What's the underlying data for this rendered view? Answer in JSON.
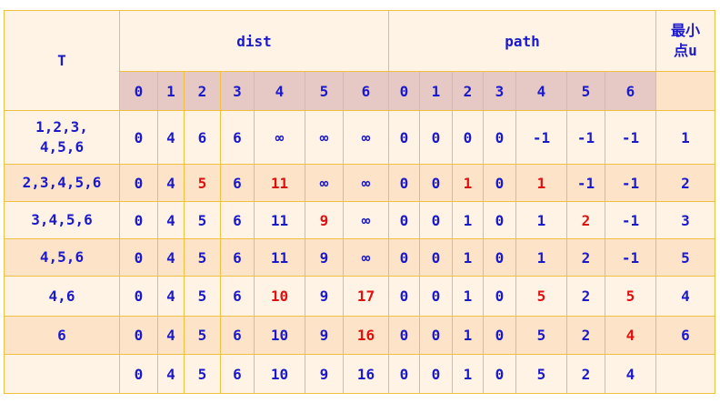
{
  "header": {
    "t": "T",
    "dist": "dist",
    "path": "path",
    "minu": "最小点u",
    "indices": [
      "0",
      "1",
      "2",
      "3",
      "4",
      "5",
      "6"
    ]
  },
  "rows": [
    {
      "t": "1,2,3,4,5,6",
      "t_lines": [
        "1,2,3,",
        "4,5,6"
      ],
      "dist": [
        "0",
        "4",
        "6",
        "6",
        "∞",
        "∞",
        "∞"
      ],
      "path": [
        "0",
        "0",
        "0",
        "0",
        "-1",
        "-1",
        "-1"
      ],
      "u": "1",
      "red_dist": [],
      "red_path": [],
      "shade": "light"
    },
    {
      "t": "2,3,4,5,6",
      "t_lines": [
        "2,3,4,5,6"
      ],
      "dist": [
        "0",
        "4",
        "5",
        "6",
        "11",
        "∞",
        "∞"
      ],
      "path": [
        "0",
        "0",
        "1",
        "0",
        "1",
        "-1",
        "-1"
      ],
      "u": "2",
      "red_dist": [
        2,
        4
      ],
      "red_path": [
        2,
        4
      ],
      "shade": "dark"
    },
    {
      "t": "3,4,5,6",
      "t_lines": [
        "3,4,5,6"
      ],
      "dist": [
        "0",
        "4",
        "5",
        "6",
        "11",
        "9",
        "∞"
      ],
      "path": [
        "0",
        "0",
        "1",
        "0",
        "1",
        "2",
        "-1"
      ],
      "u": "3",
      "red_dist": [
        5
      ],
      "red_path": [
        5
      ],
      "shade": "light"
    },
    {
      "t": "4,5,6",
      "t_lines": [
        "4,5,6"
      ],
      "dist": [
        "0",
        "4",
        "5",
        "6",
        "11",
        "9",
        "∞"
      ],
      "path": [
        "0",
        "0",
        "1",
        "0",
        "1",
        "2",
        "-1"
      ],
      "u": "5",
      "red_dist": [],
      "red_path": [],
      "shade": "dark"
    },
    {
      "t": "4,6",
      "t_lines": [
        "4,6"
      ],
      "dist": [
        "0",
        "4",
        "5",
        "6",
        "10",
        "9",
        "17"
      ],
      "path": [
        "0",
        "0",
        "1",
        "0",
        "5",
        "2",
        "5"
      ],
      "u": "4",
      "red_dist": [
        4,
        6
      ],
      "red_path": [
        4,
        6
      ],
      "shade": "light"
    },
    {
      "t": "6",
      "t_lines": [
        "6"
      ],
      "dist": [
        "0",
        "4",
        "5",
        "6",
        "10",
        "9",
        "16"
      ],
      "path": [
        "0",
        "0",
        "1",
        "0",
        "5",
        "2",
        "4"
      ],
      "u": "6",
      "red_dist": [
        6
      ],
      "red_path": [
        6
      ],
      "shade": "dark"
    },
    {
      "t": "",
      "t_lines": [
        ""
      ],
      "dist": [
        "0",
        "4",
        "5",
        "6",
        "10",
        "9",
        "16"
      ],
      "path": [
        "0",
        "0",
        "1",
        "0",
        "5",
        "2",
        "4"
      ],
      "u": "",
      "red_dist": [],
      "red_path": [],
      "shade": "light"
    }
  ]
}
